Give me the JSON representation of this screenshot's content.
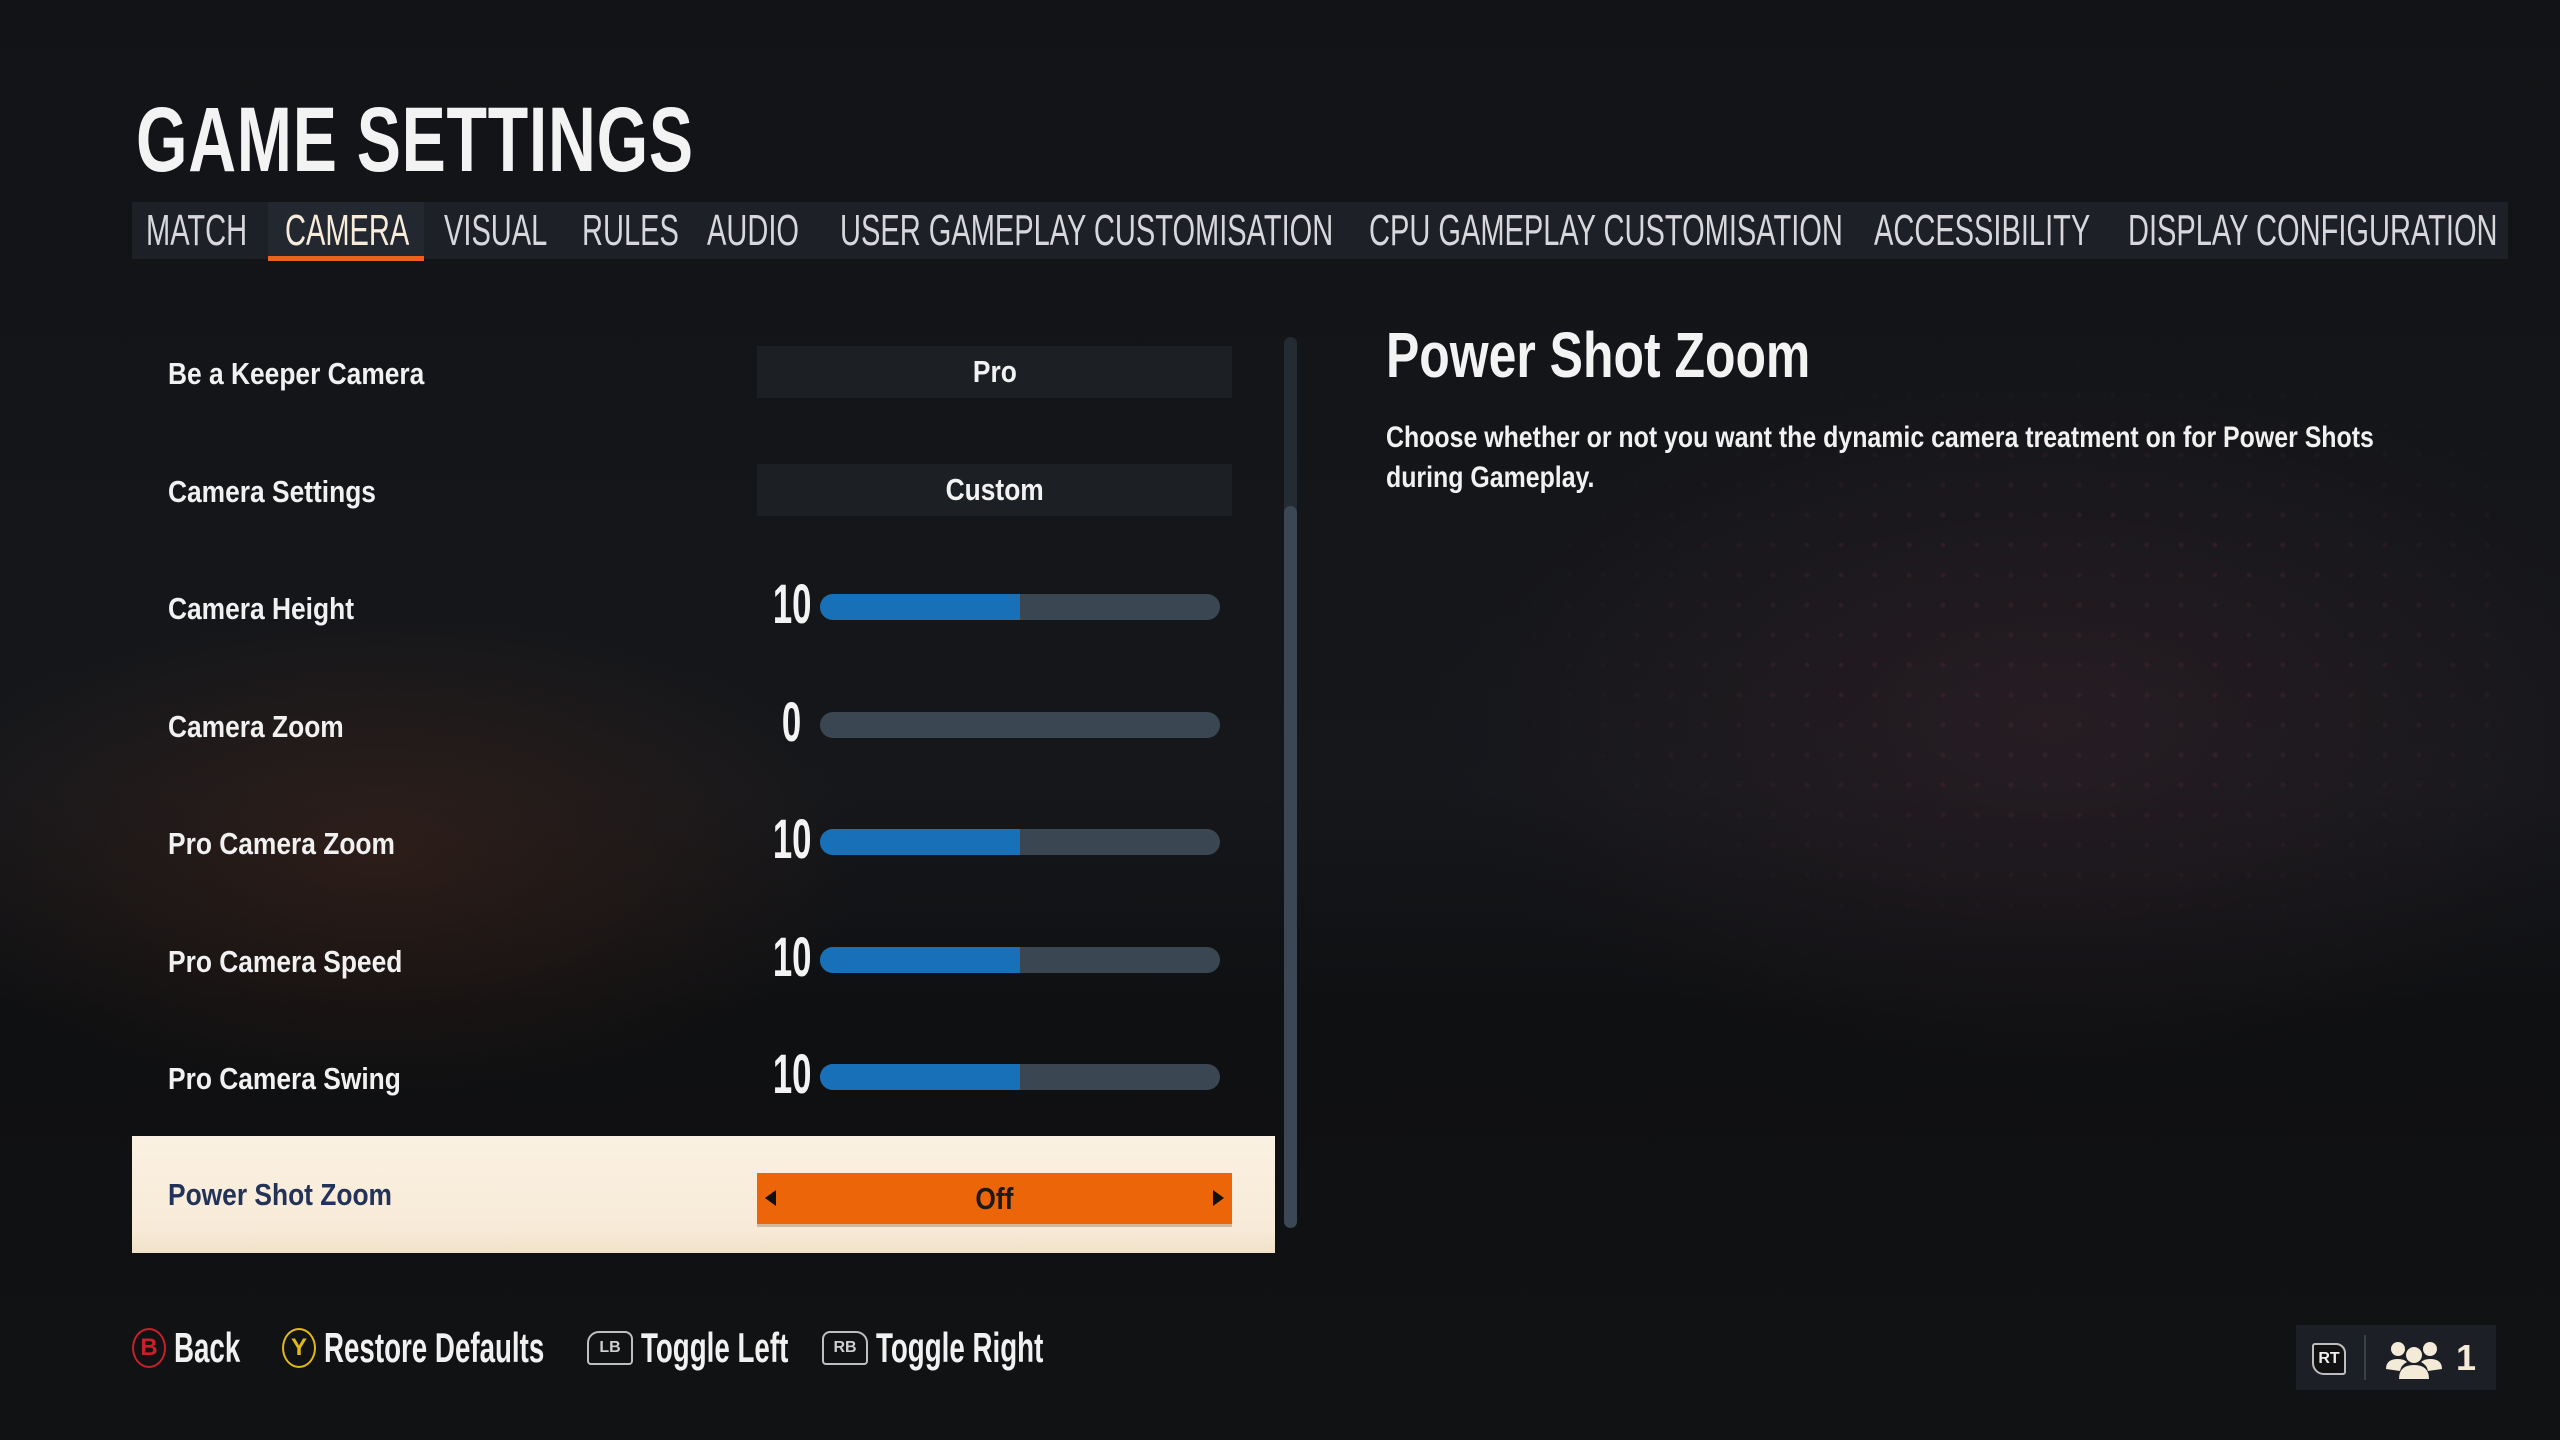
{
  "page": {
    "title": "GAME SETTINGS"
  },
  "tabs": [
    {
      "label": "MATCH",
      "active": false
    },
    {
      "label": "CAMERA",
      "active": true
    },
    {
      "label": "VISUAL",
      "active": false
    },
    {
      "label": "RULES",
      "active": false
    },
    {
      "label": "AUDIO",
      "active": false
    },
    {
      "label": "USER GAMEPLAY CUSTOMISATION",
      "active": false
    },
    {
      "label": "CPU GAMEPLAY CUSTOMISATION",
      "active": false
    },
    {
      "label": "ACCESSIBILITY",
      "active": false
    },
    {
      "label": "DISPLAY CONFIGURATION",
      "active": false
    }
  ],
  "settings": [
    {
      "label": "Be a Keeper Camera",
      "type": "select",
      "value": "Pro"
    },
    {
      "label": "Camera Settings",
      "type": "select",
      "value": "Custom"
    },
    {
      "label": "Camera Height",
      "type": "slider",
      "value": "10",
      "fill_fraction": 0.5
    },
    {
      "label": "Camera Zoom",
      "type": "slider",
      "value": "0",
      "fill_fraction": 0.0
    },
    {
      "label": "Pro Camera Zoom",
      "type": "slider",
      "value": "10",
      "fill_fraction": 0.5
    },
    {
      "label": "Pro Camera Speed",
      "type": "slider",
      "value": "10",
      "fill_fraction": 0.5
    },
    {
      "label": "Pro Camera Swing",
      "type": "slider",
      "value": "10",
      "fill_fraction": 0.5
    },
    {
      "label": "Power Shot Zoom",
      "type": "toggle",
      "value": "Off",
      "selected": true
    }
  ],
  "scroll": {
    "thumb_start_fraction": 0.19,
    "thumb_end_fraction": 1.0
  },
  "description": {
    "title": "Power Shot Zoom",
    "body": "Choose whether or not you want the dynamic camera treatment on for Power Shots during Gameplay."
  },
  "footer": {
    "hints": [
      {
        "button": "B",
        "label": "Back",
        "color": "#c8202a"
      },
      {
        "button": "Y",
        "label": "Restore Defaults",
        "color": "#e0b818"
      },
      {
        "button": "LB",
        "label": "Toggle Left"
      },
      {
        "button": "RB",
        "label": "Toggle Right"
      }
    ]
  },
  "status": {
    "trigger_button": "RT",
    "players_icon": "group-icon",
    "player_count": "1"
  },
  "colors": {
    "accent_orange": "#ec6508",
    "tab_underline": "#e8641e",
    "slider_fill": "#1870b8",
    "slider_track": "#3a4652",
    "selected_row_bg": "#f9eedd",
    "selected_label": "#233259"
  }
}
